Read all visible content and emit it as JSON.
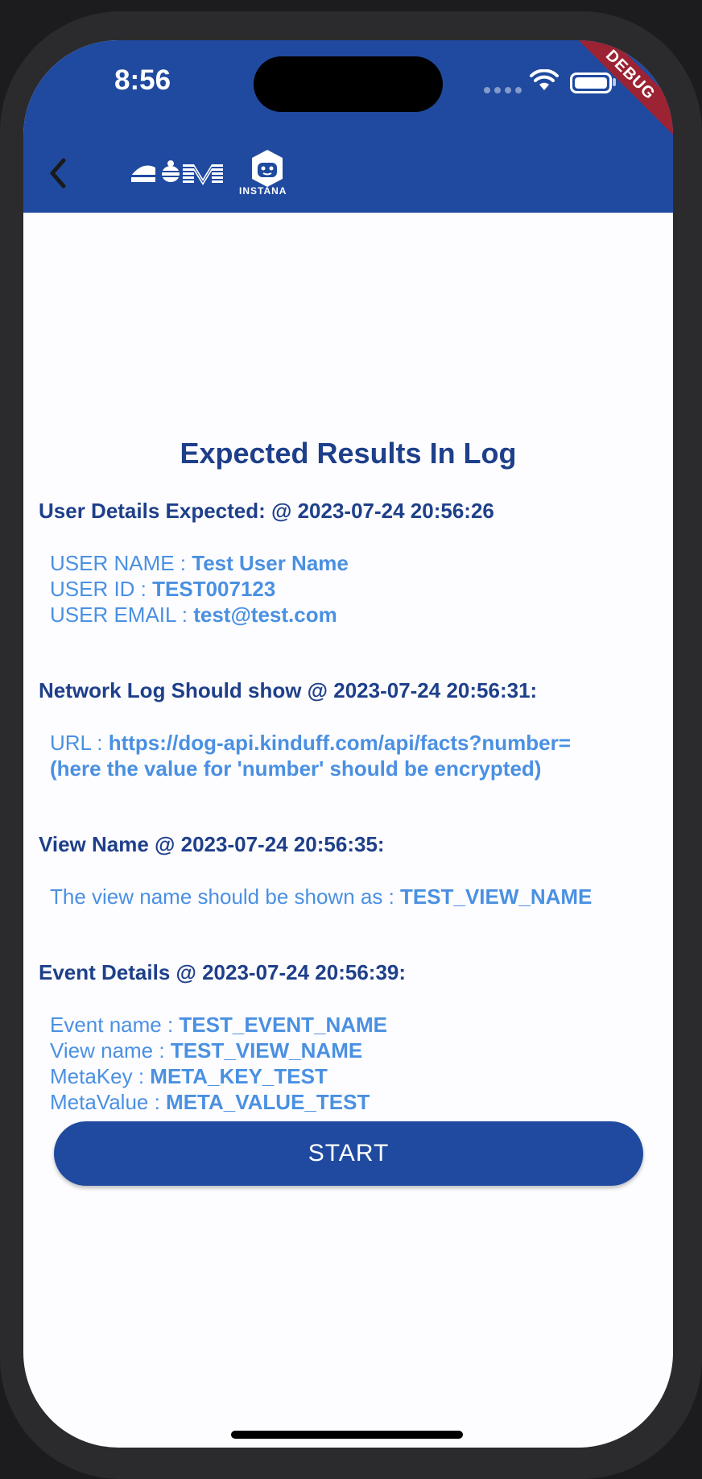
{
  "status_bar": {
    "time": "8:56"
  },
  "debug_banner": "DEBUG",
  "app_bar": {
    "instana_label": "INSTANA"
  },
  "page": {
    "title": "Expected Results In Log"
  },
  "sections": {
    "user": {
      "heading": "User Details Expected: @ 2023-07-24 20:56:26",
      "lines": [
        {
          "label": "USER NAME : ",
          "value": "Test User Name"
        },
        {
          "label": "USER ID : ",
          "value": "TEST007123"
        },
        {
          "label": "USER EMAIL : ",
          "value": "test@test.com"
        }
      ]
    },
    "network": {
      "heading": "Network Log Should show @ 2023-07-24 20:56:31:",
      "url_label": "URL : ",
      "url_value": "https://dog-api.kinduff.com/api/facts?number=",
      "url_note": "(here the value for 'number' should be encrypted)"
    },
    "view": {
      "heading": "View Name @ 2023-07-24 20:56:35:",
      "label": "The view name should be shown as : ",
      "value": "TEST_VIEW_NAME"
    },
    "event": {
      "heading": "Event Details @ 2023-07-24 20:56:39:",
      "lines": [
        {
          "label": "Event name : ",
          "value": "TEST_EVENT_NAME"
        },
        {
          "label": "View name : ",
          "value": "TEST_VIEW_NAME"
        },
        {
          "label": "MetaKey : ",
          "value": "META_KEY_TEST"
        },
        {
          "label": "MetaValue : ",
          "value": "META_VALUE_TEST"
        }
      ]
    }
  },
  "start_button": {
    "label": "START"
  },
  "colors": {
    "primary": "#1f4aa0",
    "heading": "#1e3f8a",
    "detail": "#4a90e2",
    "debug": "#9b2333"
  }
}
